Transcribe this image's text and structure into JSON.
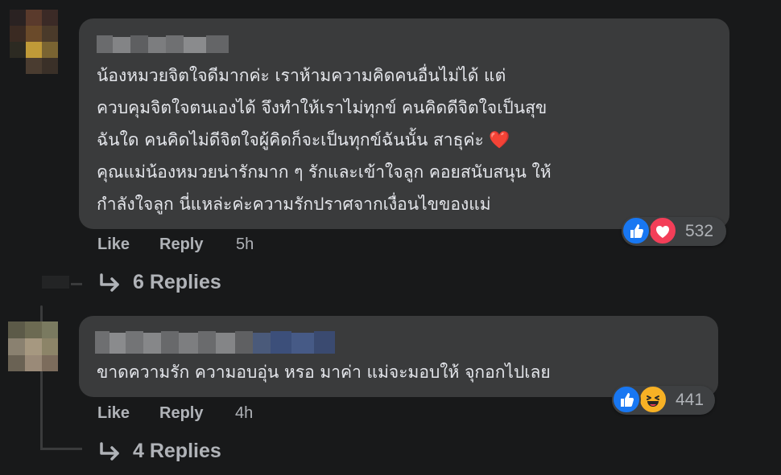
{
  "comments": [
    {
      "text": "น้องหมวยจิตใจดีมากค่ะ เราห้ามความคิดคนอื่นไม่ได้ แต่\nควบคุมจิตใจตนเองได้ จึงทำให้เราไม่ทุกข์ คนคิดดีจิตใจเป็นสุข\nฉันใด คนคิดไม่ดีจิตใจผู้คิดก็จะเป็นทุกข์ฉันนั้น สาธุค่ะ ❤️\nคุณแม่น้องหมวยน่ารักมาก ๆ รักและเข้าใจลูก คอยสนับสนุน ให้\nกำลังใจลูก นี่แหล่ะค่ะความรักปราศจากเงื่อนไขของแม่",
      "like_label": "Like",
      "reply_label": "Reply",
      "time": "5h",
      "reaction_count": "532",
      "reactions": [
        "like-icon",
        "love-icon"
      ],
      "replies_label": "6 Replies"
    },
    {
      "text": "ขาดความรัก ความอบอุ่น หรอ มาค่า แม่จะมอบให้ จุกอกไปเลย",
      "like_label": "Like",
      "reply_label": "Reply",
      "time": "4h",
      "reaction_count": "441",
      "reactions": [
        "like-icon",
        "haha-icon"
      ],
      "replies_label": "4 Replies"
    }
  ],
  "colors": {
    "background": "#18191a",
    "bubble": "#3a3b3c",
    "text": "#e4e6eb",
    "secondary_text": "#b0b3b8",
    "like_blue": "#1877f2",
    "love_red": "#f33e58",
    "haha_yellow": "#f7b125"
  }
}
